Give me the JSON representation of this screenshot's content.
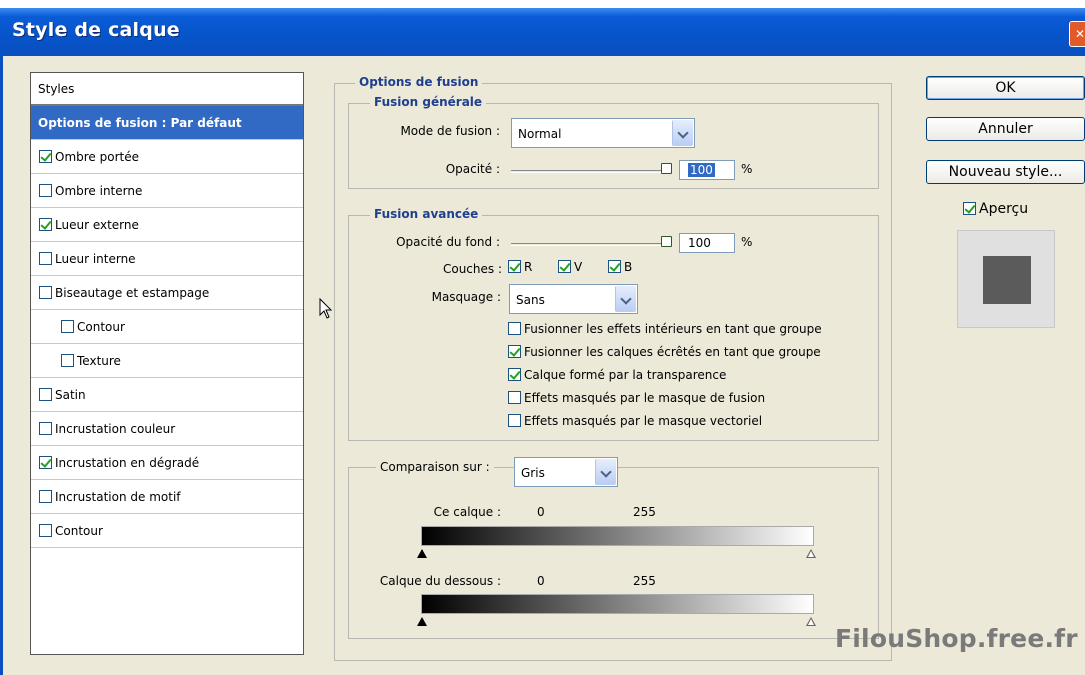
{
  "window": {
    "title": "Style de calque",
    "close_glyph": "✕"
  },
  "styles": {
    "header": "Styles",
    "items": [
      {
        "label": "Options de fusion : Par défaut",
        "selected": true
      },
      {
        "label": "Ombre portée",
        "checked": true
      },
      {
        "label": "Ombre interne",
        "checked": false
      },
      {
        "label": "Lueur externe",
        "checked": true
      },
      {
        "label": "Lueur interne",
        "checked": false
      },
      {
        "label": "Biseautage et estampage",
        "checked": false
      },
      {
        "label": "Contour",
        "checked": false
      },
      {
        "label": "Texture",
        "checked": false
      },
      {
        "label": "Satin",
        "checked": false
      },
      {
        "label": "Incrustation couleur",
        "checked": false
      },
      {
        "label": "Incrustation en dégradé",
        "checked": true
      },
      {
        "label": "Incrustation de motif",
        "checked": false
      },
      {
        "label": "Contour",
        "checked": false
      }
    ]
  },
  "options": {
    "title": "Options de fusion",
    "general": {
      "title": "Fusion générale",
      "mode_label": "Mode de fusion :",
      "mode_value": "Normal",
      "opacity_label": "Opacité :",
      "opacity_value": "100",
      "percent": "%"
    },
    "advanced": {
      "title": "Fusion avancée",
      "fill_label": "Opacité du fond :",
      "fill_value": "100",
      "percent": "%",
      "channels_label": "Couches :",
      "channel_r": "R",
      "channel_v": "V",
      "channel_b": "B",
      "knockout_label": "Masquage :",
      "knockout_value": "Sans",
      "checks": [
        {
          "label": "Fusionner les effets intérieurs en tant que groupe",
          "checked": false
        },
        {
          "label": "Fusionner les calques écrêtés en tant que groupe",
          "checked": true
        },
        {
          "label": "Calque formé par la transparence",
          "checked": true
        },
        {
          "label": "Effets masqués par le masque de fusion",
          "checked": false
        },
        {
          "label": "Effets masqués par le masque vectoriel",
          "checked": false
        }
      ]
    },
    "blendif": {
      "label": "Comparaison sur :",
      "value": "Gris",
      "this_layer_label": "Ce calque :",
      "this_min": "0",
      "this_max": "255",
      "under_layer_label": "Calque du dessous :",
      "under_min": "0",
      "under_max": "255"
    }
  },
  "buttons": {
    "ok": "OK",
    "cancel": "Annuler",
    "new_style": "Nouveau style...",
    "preview_label": "Aperçu"
  },
  "watermark": "FilouShop.free.fr",
  "colors": {
    "accent": "#316ac5",
    "titlebar": "#0654c9",
    "check": "#21a121"
  }
}
